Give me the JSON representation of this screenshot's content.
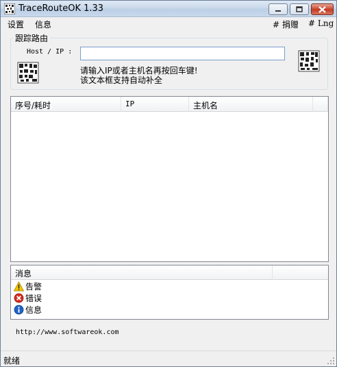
{
  "window": {
    "title": "TraceRouteOK 1.33"
  },
  "menu": {
    "settings": "设置",
    "info": "信息",
    "donate": "# 捐赠",
    "lng": "# Lng"
  },
  "trace_group": {
    "title": "跟踪路由",
    "host_label": "Host / IP :",
    "host_value": "",
    "host_placeholder": "",
    "hint_line1": "请输入IP或者主机名再按回车键!",
    "hint_line2": "该文本框支持自动补全"
  },
  "result_table": {
    "columns": [
      "序号/耗时",
      "IP",
      "主机名",
      ""
    ],
    "rows": []
  },
  "messages": {
    "header": "消息",
    "items": [
      {
        "icon": "warning-icon",
        "label": "告警"
      },
      {
        "icon": "error-icon",
        "label": "错误"
      },
      {
        "icon": "info-icon",
        "label": "信息"
      }
    ]
  },
  "website": "http://www.softwareok.com",
  "status": "就绪",
  "colors": {
    "warning": "#f5c400",
    "error": "#d62a1e",
    "info": "#1f63c6"
  }
}
